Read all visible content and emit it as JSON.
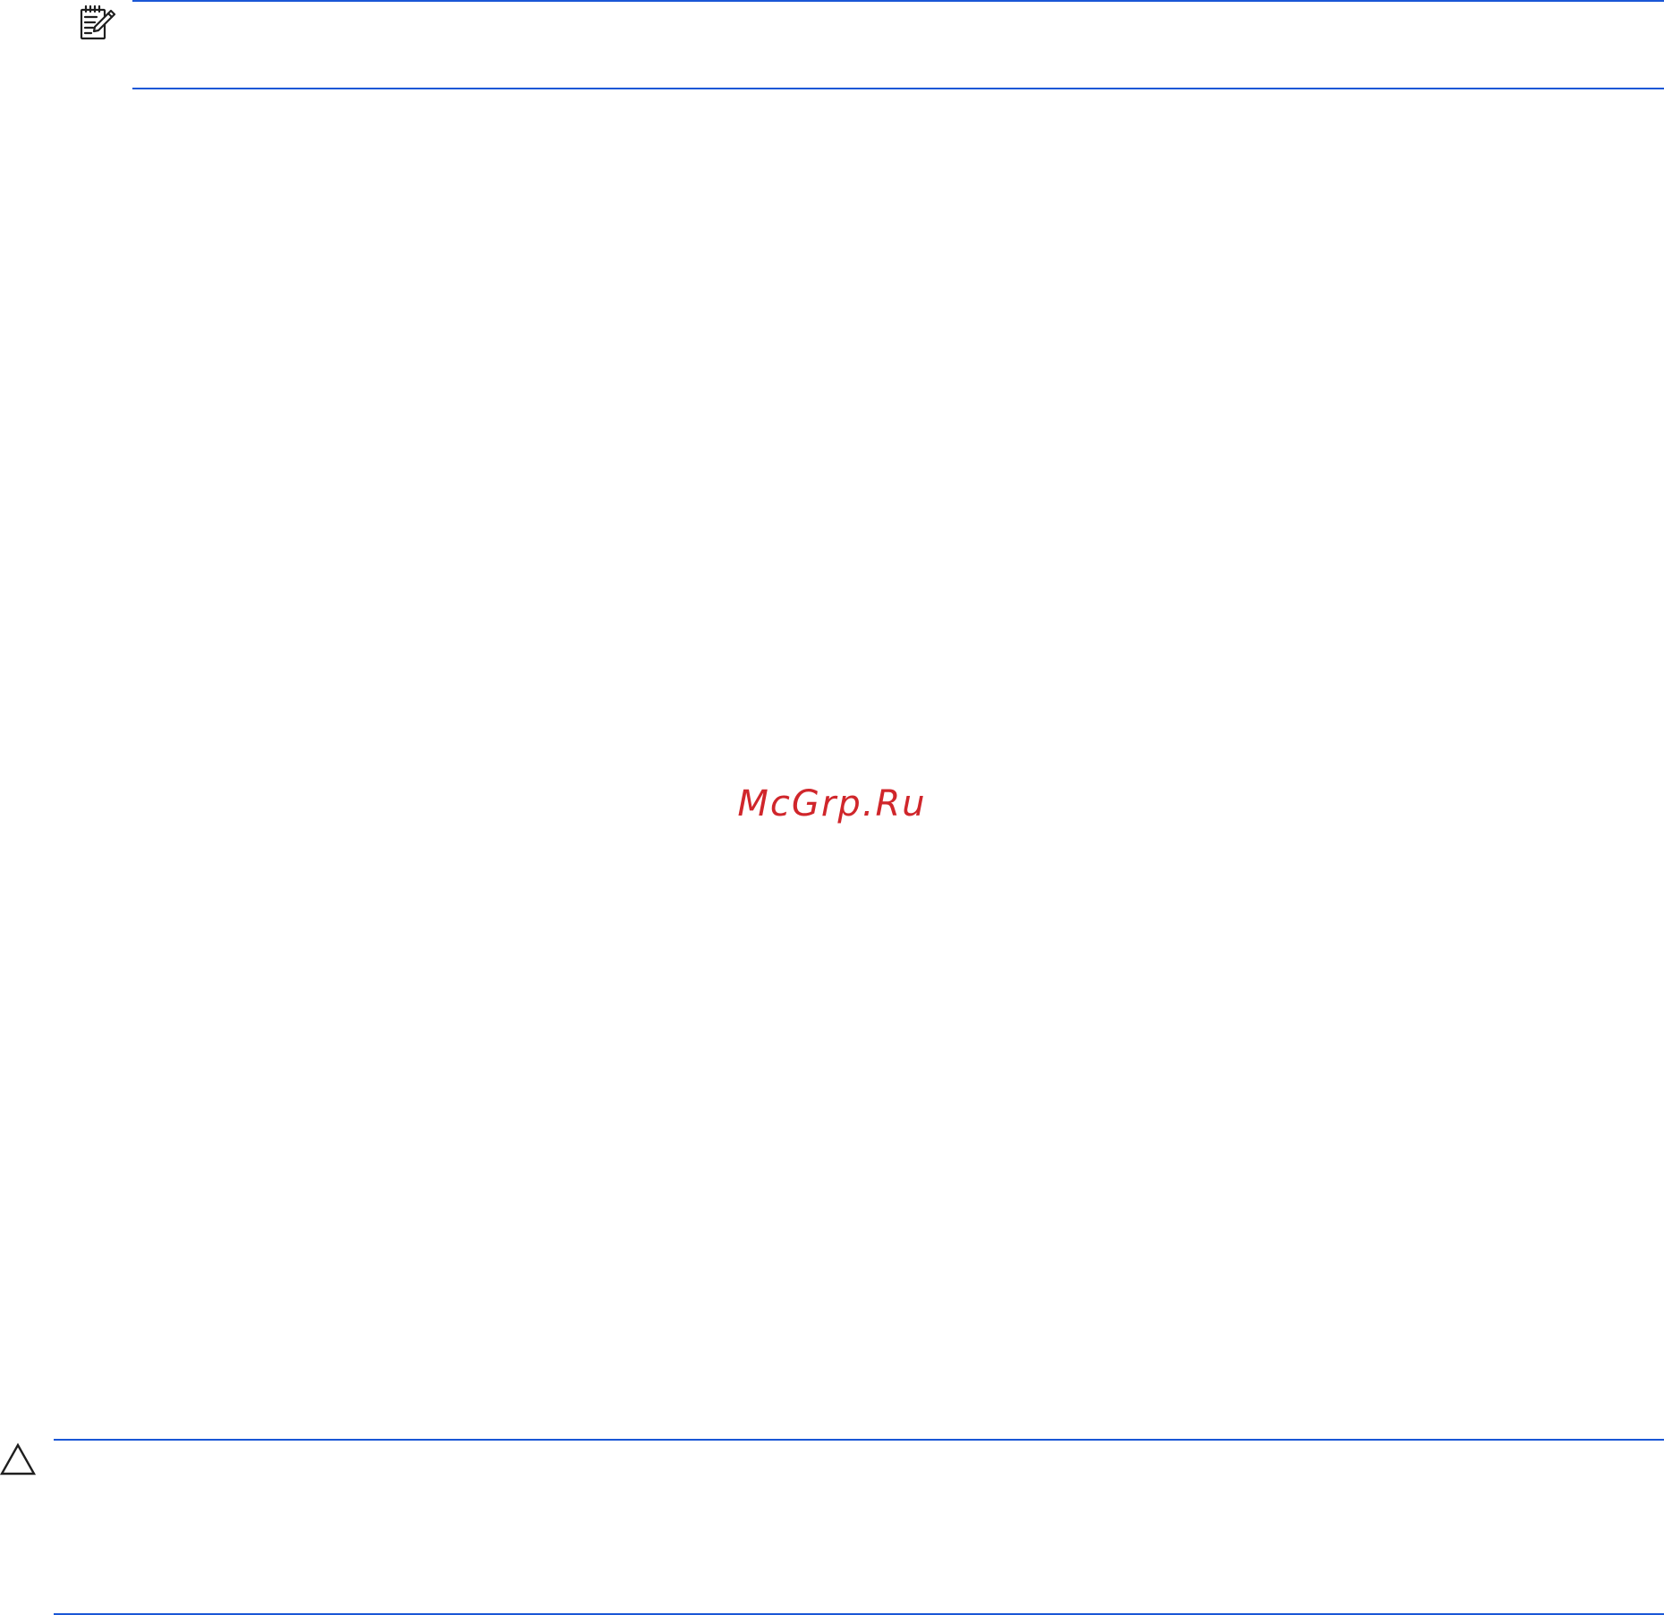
{
  "watermark": {
    "text": "McGrp.Ru",
    "color": "#d0262b"
  },
  "note": {
    "icon": "note-pad-pencil-icon"
  },
  "caution": {
    "icon": "caution-triangle-icon"
  },
  "colors": {
    "rule": "#1a57d6",
    "icon": "#1f1f1f",
    "background": "#ffffff"
  }
}
